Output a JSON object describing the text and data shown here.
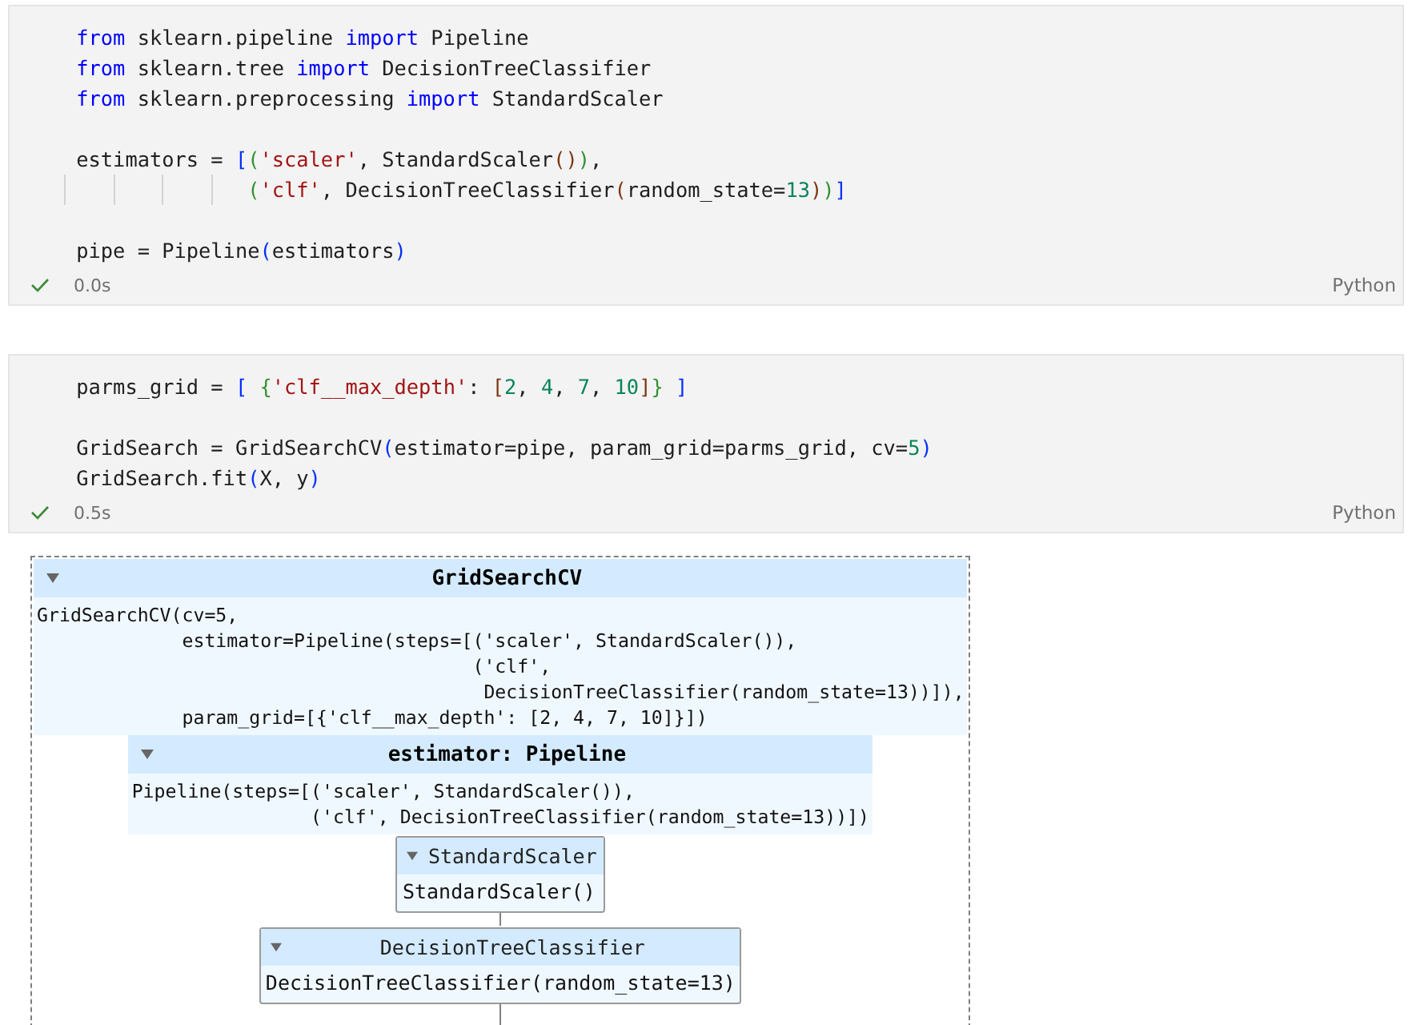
{
  "cells": [
    {
      "code_blocks": [
        [
          {
            "tokens": [
              {
                "kind": "kw",
                "text": "from"
              },
              {
                "kind": "plain",
                "text": " sklearn.pipeline "
              },
              {
                "kind": "kw",
                "text": "import"
              },
              {
                "kind": "plain",
                "text": " Pipeline"
              }
            ]
          },
          {
            "tokens": [
              {
                "kind": "kw",
                "text": "from"
              },
              {
                "kind": "plain",
                "text": " sklearn.tree "
              },
              {
                "kind": "kw",
                "text": "import"
              },
              {
                "kind": "plain",
                "text": " DecisionTreeClassifier"
              }
            ]
          },
          {
            "tokens": [
              {
                "kind": "kw",
                "text": "from"
              },
              {
                "kind": "plain",
                "text": " sklearn.preprocessing "
              },
              {
                "kind": "kw",
                "text": "import"
              },
              {
                "kind": "plain",
                "text": " StandardScaler"
              }
            ]
          }
        ],
        [
          {
            "tokens": [
              {
                "kind": "plain",
                "text": "estimators = "
              },
              {
                "kind": "b1",
                "text": "["
              },
              {
                "kind": "b2",
                "text": "("
              },
              {
                "kind": "str",
                "text": "'scaler'"
              },
              {
                "kind": "plain",
                "text": ", StandardScaler"
              },
              {
                "kind": "b3",
                "text": "()"
              },
              {
                "kind": "b2",
                "text": ")"
              },
              {
                "kind": "plain",
                "text": ","
              }
            ]
          },
          {
            "indent_guides": true,
            "tokens": [
              {
                "kind": "b2",
                "text": "              ("
              },
              {
                "kind": "str",
                "text": "'clf'"
              },
              {
                "kind": "plain",
                "text": ", DecisionTreeClassifier"
              },
              {
                "kind": "b3",
                "text": "("
              },
              {
                "kind": "plain",
                "text": "random_state="
              },
              {
                "kind": "num",
                "text": "13"
              },
              {
                "kind": "b3",
                "text": ")"
              },
              {
                "kind": "b2",
                "text": ")"
              },
              {
                "kind": "b1",
                "text": "]"
              }
            ]
          }
        ],
        [
          {
            "tokens": [
              {
                "kind": "plain",
                "text": "pipe = Pipeline"
              },
              {
                "kind": "b1",
                "text": "("
              },
              {
                "kind": "plain",
                "text": "estimators"
              },
              {
                "kind": "b1",
                "text": ")"
              }
            ]
          }
        ]
      ],
      "status": {
        "succeeded": true,
        "time": "0.0s"
      },
      "language": "Python"
    },
    {
      "code_blocks": [
        [
          {
            "tokens": [
              {
                "kind": "plain",
                "text": "parms_grid = "
              },
              {
                "kind": "b1",
                "text": "[ "
              },
              {
                "kind": "b2",
                "text": "{"
              },
              {
                "kind": "str",
                "text": "'clf__max_depth'"
              },
              {
                "kind": "plain",
                "text": ": "
              },
              {
                "kind": "b3",
                "text": "["
              },
              {
                "kind": "num",
                "text": "2"
              },
              {
                "kind": "plain",
                "text": ", "
              },
              {
                "kind": "num",
                "text": "4"
              },
              {
                "kind": "plain",
                "text": ", "
              },
              {
                "kind": "num",
                "text": "7"
              },
              {
                "kind": "plain",
                "text": ", "
              },
              {
                "kind": "num",
                "text": "10"
              },
              {
                "kind": "b3",
                "text": "]"
              },
              {
                "kind": "b2",
                "text": "}"
              },
              {
                "kind": "b1",
                "text": " ]"
              }
            ]
          }
        ],
        [
          {
            "tokens": [
              {
                "kind": "plain",
                "text": "GridSearch = GridSearchCV"
              },
              {
                "kind": "b1",
                "text": "("
              },
              {
                "kind": "plain",
                "text": "estimator=pipe, param_grid=parms_grid, cv="
              },
              {
                "kind": "num",
                "text": "5"
              },
              {
                "kind": "b1",
                "text": ")"
              }
            ]
          },
          {
            "tokens": [
              {
                "kind": "plain",
                "text": "GridSearch.fit"
              },
              {
                "kind": "b1",
                "text": "("
              },
              {
                "kind": "plain",
                "text": "X, y"
              },
              {
                "kind": "b1",
                "text": ")"
              }
            ]
          }
        ]
      ],
      "status": {
        "succeeded": true,
        "time": "0.5s"
      },
      "language": "Python",
      "output": {
        "kind": "meta",
        "title": "GridSearchCV",
        "expanded": true,
        "repr": [
          "GridSearchCV(cv=5,",
          "             estimator=Pipeline(steps=[('scaler', StandardScaler()),",
          "                                       ('clf',",
          "                                        DecisionTreeClassifier(random_state=13))]),",
          "             param_grid=[{'clf__max_depth': [2, 4, 7, 10]}])"
        ],
        "children": [
          {
            "kind": "meta",
            "title": "estimator: Pipeline",
            "expanded": true,
            "repr": [
              "Pipeline(steps=[('scaler', StandardScaler()),",
              "                ('clf', DecisionTreeClassifier(random_state=13))])"
            ],
            "children": [
              {
                "kind": "leaf",
                "title": "StandardScaler",
                "expanded": true,
                "repr": [
                  "StandardScaler()"
                ]
              },
              {
                "kind": "leaf",
                "title": "DecisionTreeClassifier",
                "expanded": true,
                "repr": [
                  "DecisionTreeClassifier(random_state=13)"
                ]
              }
            ]
          }
        ]
      }
    }
  ]
}
